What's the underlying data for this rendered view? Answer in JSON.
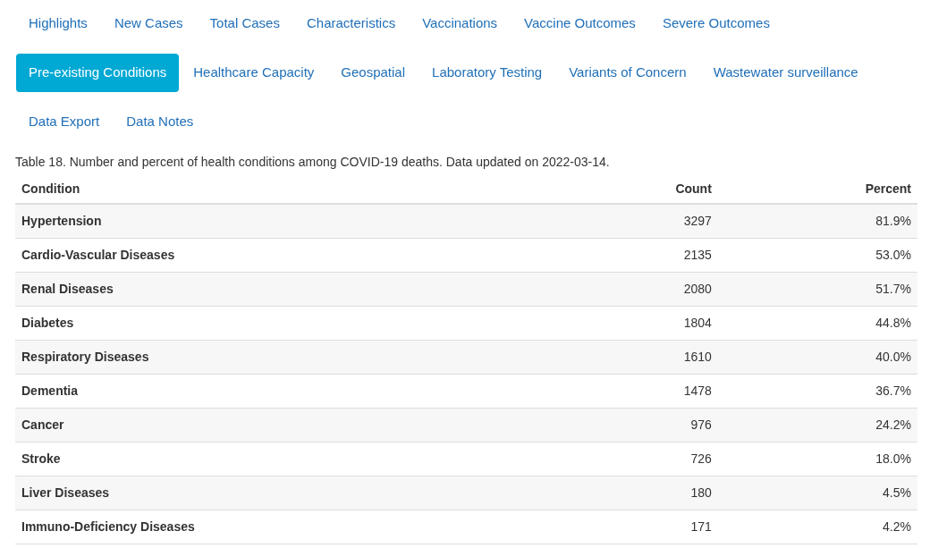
{
  "tab_rows": [
    [
      {
        "label": "Highlights",
        "selected": false
      },
      {
        "label": "New Cases",
        "selected": false
      },
      {
        "label": "Total Cases",
        "selected": false
      },
      {
        "label": "Characteristics",
        "selected": false
      },
      {
        "label": "Vaccinations",
        "selected": false
      },
      {
        "label": "Vaccine Outcomes",
        "selected": false
      },
      {
        "label": "Severe Outcomes",
        "selected": false
      }
    ],
    [
      {
        "label": "Pre-existing Conditions",
        "selected": true
      },
      {
        "label": "Healthcare Capacity",
        "selected": false
      },
      {
        "label": "Geospatial",
        "selected": false
      },
      {
        "label": "Laboratory Testing",
        "selected": false
      },
      {
        "label": "Variants of Concern",
        "selected": false
      },
      {
        "label": "Wastewater surveillance",
        "selected": false
      }
    ],
    [
      {
        "label": "Data Export",
        "selected": false
      },
      {
        "label": "Data Notes",
        "selected": false
      }
    ]
  ],
  "table": {
    "caption": "Table 18. Number and percent of health conditions among COVID-19 deaths. Data updated on 2022-03-14.",
    "columns": [
      "Condition",
      "Count",
      "Percent"
    ],
    "rows": [
      [
        "Hypertension",
        "3297",
        "81.9%"
      ],
      [
        "Cardio-Vascular Diseases",
        "2135",
        "53.0%"
      ],
      [
        "Renal Diseases",
        "2080",
        "51.7%"
      ],
      [
        "Diabetes",
        "1804",
        "44.8%"
      ],
      [
        "Respiratory Diseases",
        "1610",
        "40.0%"
      ],
      [
        "Dementia",
        "1478",
        "36.7%"
      ],
      [
        "Cancer",
        "976",
        "24.2%"
      ],
      [
        "Stroke",
        "726",
        "18.0%"
      ],
      [
        "Liver Diseases",
        "180",
        "4.5%"
      ],
      [
        "Immuno-Deficiency Diseases",
        "171",
        "4.2%"
      ]
    ]
  }
}
